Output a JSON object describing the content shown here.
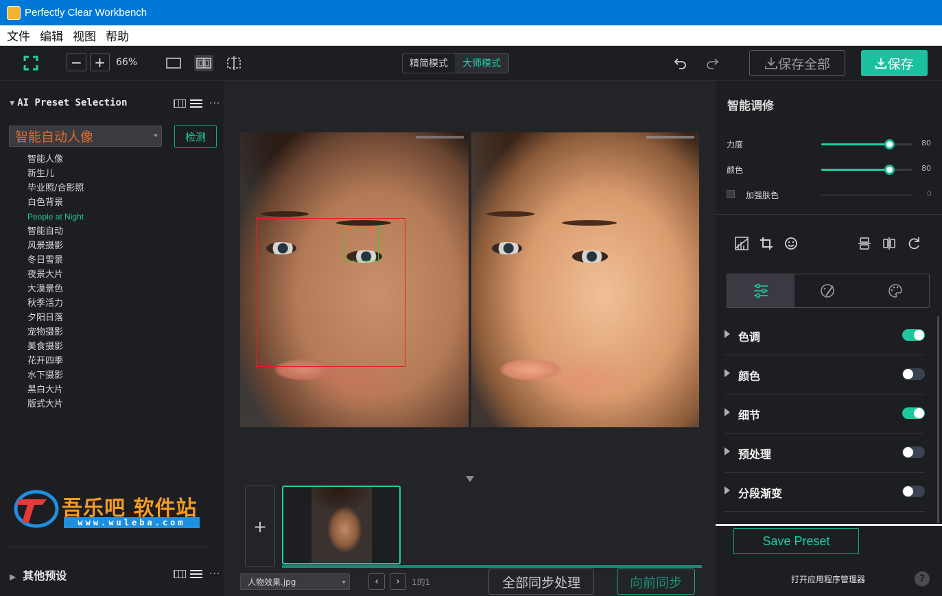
{
  "window": {
    "title": "Perfectly Clear Workbench"
  },
  "menu": {
    "items": [
      "文件",
      "编辑",
      "视图",
      "帮助"
    ]
  },
  "toolbar": {
    "zoom_out": "−",
    "zoom_in": "+",
    "zoom_level": "66%",
    "mode_simple": "精简模式",
    "mode_master": "大师模式",
    "save_all": "保存全部",
    "save": "保存"
  },
  "left_panel": {
    "header": "AI Preset Selection",
    "selected_preset": "智能自动人像",
    "detect_button": "检测",
    "presets": [
      "智能人像",
      "新生儿",
      "毕业照/合影照",
      "白色背景",
      "People at Night",
      "智能自动",
      "风景摄影",
      "冬日雪景",
      "夜景大片",
      "大漠景色",
      "秋季活力",
      "夕阳日落",
      "宠物摄影",
      "美食摄影",
      "花开四季",
      "水下摄影",
      "黑白大片",
      "版式大片"
    ],
    "active_preset": "People at Night",
    "logo_text": "吾乐吧 软件站",
    "logo_url": "www.wuleba.com",
    "other_presets": "其他预设"
  },
  "center": {
    "file_name": "人物效果.jpg",
    "page_count": "1的1",
    "sync_all": "全部同步处理",
    "sync_forward": "向前同步",
    "add": "+",
    "prev": "‹",
    "next": "›"
  },
  "right_panel": {
    "title": "智能调修",
    "sliders": [
      {
        "label": "力度",
        "value": 80
      },
      {
        "label": "颜色",
        "value": 80
      },
      {
        "label": "加强肤色",
        "value": 0
      }
    ],
    "sections": [
      {
        "label": "色调",
        "enabled": true
      },
      {
        "label": "颜色",
        "enabled": false
      },
      {
        "label": "细节",
        "enabled": true
      },
      {
        "label": "预处理",
        "enabled": false
      },
      {
        "label": "分段渐变",
        "enabled": false
      }
    ],
    "save_preset": "Save Preset",
    "open_manager": "打开应用程序管理器",
    "help": "?"
  },
  "colors": {
    "accent": "#1cd1a3",
    "titlebar": "#0078d7",
    "preset_selected": "#e06a2a"
  }
}
